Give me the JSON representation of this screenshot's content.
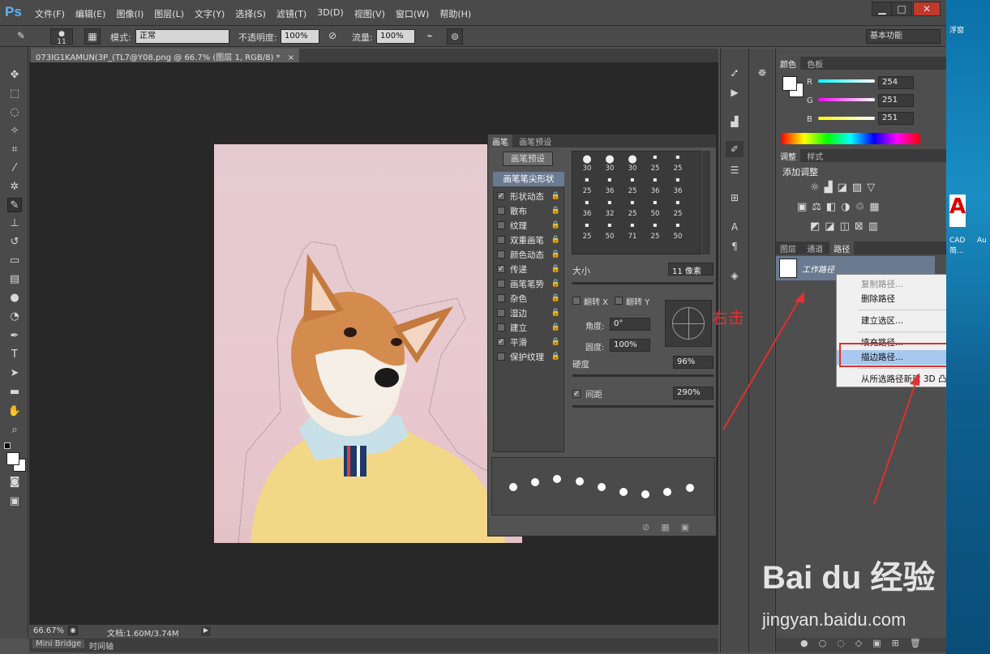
{
  "app": {
    "logo": "Ps"
  },
  "menu": [
    "文件(F)",
    "编辑(E)",
    "图像(I)",
    "图层(L)",
    "文字(Y)",
    "选择(S)",
    "滤镜(T)",
    "3D(D)",
    "视图(V)",
    "窗口(W)",
    "帮助(H)"
  ],
  "window_buttons": {
    "min": "▁",
    "max": "□",
    "close": "✕"
  },
  "options": {
    "brush_size": "11",
    "mode_label": "模式:",
    "mode_value": "正常",
    "opacity_label": "不透明度:",
    "opacity_value": "100%",
    "flow_label": "流量:",
    "flow_value": "100%",
    "workspace": "基本功能"
  },
  "document": {
    "tab": "073IG1KAMUN(3P_(TL7@Y08.png @ 66.7% (图层 1, RGB/8) *",
    "close": "×"
  },
  "status": {
    "zoom": "66.67%",
    "doc": "文档:1.60M/3.74M"
  },
  "bottom_tabs": [
    "Mini Bridge",
    "时间轴"
  ],
  "color_panel": {
    "tabs": [
      "颜色",
      "色板"
    ],
    "r_label": "R",
    "r": "254",
    "g_label": "G",
    "g": "251",
    "b_label": "B",
    "b": "251"
  },
  "adjust_panel": {
    "tabs": [
      "调整",
      "样式"
    ],
    "title": "添加调整"
  },
  "paths_panel": {
    "tabs": [
      "图层",
      "通道",
      "路径"
    ],
    "path_name": "工作路径"
  },
  "context_menu": {
    "items": [
      "复制路径...",
      "删除路径",
      "建立选区...",
      "填充路径...",
      "描边路径...",
      "从所选路径新建 3D 凸出"
    ],
    "highlighted": "描边路径..."
  },
  "annotation": {
    "text": "右击"
  },
  "brush_panel": {
    "tabs": [
      "画笔",
      "画笔预设"
    ],
    "preset_button": "画笔预设",
    "tip_shape": "画笔笔尖形状",
    "options": [
      {
        "label": "形状动态",
        "checked": true
      },
      {
        "label": "散布",
        "checked": false
      },
      {
        "label": "纹理",
        "checked": false
      },
      {
        "label": "双重画笔",
        "checked": false
      },
      {
        "label": "颜色动态",
        "checked": false
      },
      {
        "label": "传递",
        "checked": true
      },
      {
        "label": "画笔笔势",
        "checked": false
      },
      {
        "label": "杂色",
        "checked": false
      },
      {
        "label": "湿边",
        "checked": false
      },
      {
        "label": "建立",
        "checked": false
      },
      {
        "label": "平滑",
        "checked": true
      },
      {
        "label": "保护纹理",
        "checked": false
      }
    ],
    "sizes": [
      "30",
      "30",
      "30",
      "25",
      "25",
      "25",
      "36",
      "25",
      "36",
      "36",
      "36",
      "32",
      "25",
      "50",
      "25",
      "25",
      "50",
      "71",
      "25",
      "50"
    ],
    "size_label": "大小",
    "size_value": "11 像素",
    "flip_x": "翻转 X",
    "flip_y": "翻转 Y",
    "angle_label": "角度:",
    "angle_value": "0°",
    "round_label": "圆度:",
    "round_value": "100%",
    "hardness_label": "硬度",
    "hardness_value": "96%",
    "spacing_label": "间距",
    "spacing_value": "290%"
  },
  "watermark": {
    "text": "Bai du 经验",
    "url": "jingyan.baidu.com"
  },
  "taskbar": {
    "items": [
      "浮窗",
      "CAD 简...",
      "Au"
    ]
  },
  "colors": {
    "accent_red": "#e03030",
    "highlight": "#a8c8ef"
  }
}
